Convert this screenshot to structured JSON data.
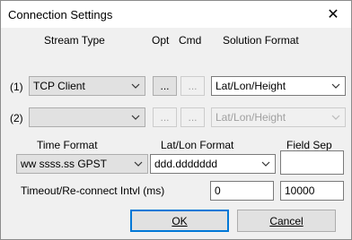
{
  "window": {
    "title": "Connection Settings",
    "close_glyph": "✕"
  },
  "headers": {
    "stream_type": "Stream Type",
    "opt": "Opt",
    "cmd": "Cmd",
    "solution_format": "Solution Format",
    "time_format": "Time Format",
    "latlon_format": "Lat/Lon Format",
    "field_sep": "Field Sep"
  },
  "row1": {
    "label": "(1)",
    "stream_type": "TCP Client",
    "opt_label": "...",
    "cmd_label": "...",
    "solution_format": "Lat/Lon/Height"
  },
  "row2": {
    "label": "(2)",
    "stream_type": "",
    "opt_label": "...",
    "cmd_label": "...",
    "solution_format": "Lat/Lon/Height"
  },
  "time_format": {
    "value": "ww ssss.ss GPST"
  },
  "latlon_format": {
    "value": "ddd.ddddddd"
  },
  "field_sep": {
    "value": ""
  },
  "timeout": {
    "label": "Timeout/Re-connect Intvl (ms)",
    "timeout_value": "0",
    "reconnect_value": "10000"
  },
  "buttons": {
    "ok_label": "OK",
    "cancel_label": "Cancel"
  }
}
